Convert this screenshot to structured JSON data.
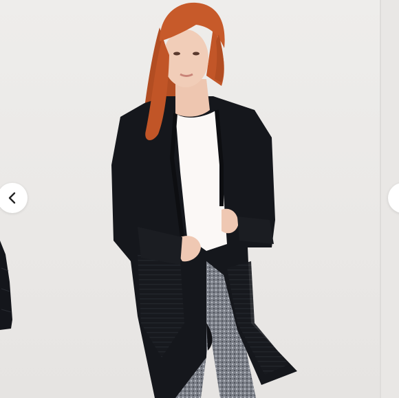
{
  "carousel": {
    "prev_icon": "chevron-left-icon",
    "next_icon": "chevron-right-icon",
    "image_subject": "product-photo"
  },
  "colors": {
    "background": "#ebe9e7",
    "cardigan": "#15171c",
    "top": "#fbf8f6",
    "hair": "#c4582a",
    "nav_button": "#ffffff"
  }
}
